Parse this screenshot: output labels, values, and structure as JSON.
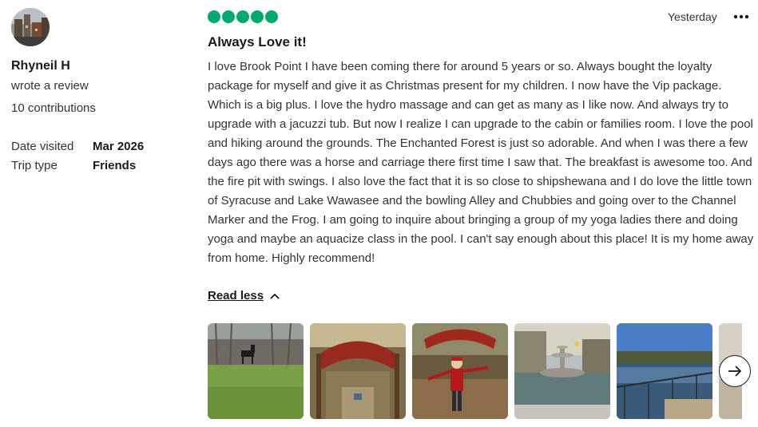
{
  "reviewer": {
    "name": "Rhyneil H",
    "action": "wrote a review",
    "contributions": "10 contributions"
  },
  "details": {
    "date_visited_label": "Date visited",
    "date_visited_value": "Mar 2026",
    "trip_type_label": "Trip type",
    "trip_type_value": "Friends"
  },
  "review": {
    "rating": 5,
    "rating_color": "#00aa6c",
    "posted": "Yesterday",
    "title": "Always Love it!",
    "body": "I love Brook Point I have been coming there for around 5 years or so. Always bought the loyalty package for myself and give it as Christmas present for my children. I now have the Vip package. Which is a big plus. I love the hydro massage and can get as many as I like now. And always try to upgrade with a jacuzzi tub. But now I realize I can upgrade to the cabin or families room. I love the pool and hiking around the grounds. The Enchanted Forest is just so adorable. And when I was there a few days ago there was a horse and carriage there first time I saw that. The breakfast is awesome too. And the fire pit with swings. I also love the fact that it is so close to shipshewana and I do love the little town of Syracuse and Lake Wawasee and the bowling Alley and Chubbies and going over to the Channel Marker and the Frog. I am going to inquire about bringing a group of my yoga ladies there and doing yoga and maybe an aquacize class in the pool. I can't say enough about this place! It is my home away from home. Highly recommend!",
    "read_less": "Read less"
  },
  "icons": {
    "more": "more-options-icon",
    "read_less": "chevron-up-icon",
    "next": "arrow-right-icon"
  },
  "photos": [
    {
      "subject": "horse-in-field-photo"
    },
    {
      "subject": "enchanted-forest-sign-photo"
    },
    {
      "subject": "woman-on-bridge-photo"
    },
    {
      "subject": "fountain-photo"
    },
    {
      "subject": "lake-with-railing-photo"
    },
    {
      "subject": "partial-photo"
    }
  ]
}
